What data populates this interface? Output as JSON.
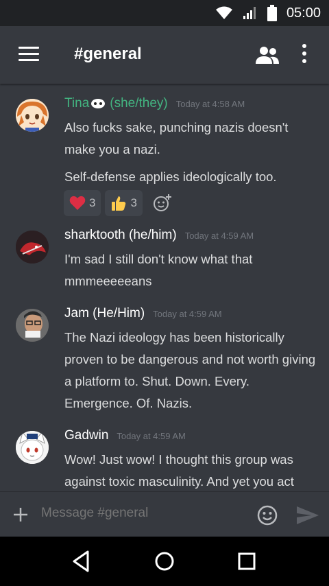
{
  "status_bar": {
    "time": "05:00"
  },
  "header": {
    "channel_title": "#general",
    "menu_icon": "hamburger-menu-icon",
    "members_icon": "members-icon",
    "more_icon": "more-vertical-icon"
  },
  "messages": [
    {
      "author": "Tina",
      "author_suffix": "(she/they)",
      "author_color": "#43b581",
      "timestamp": "Today at 4:58 AM",
      "lines": [
        "Also fucks sake, punching nazis doesn't make you a nazi.",
        "Self-defense applies ideologically too."
      ],
      "reactions": [
        {
          "emoji": "heart-emoji",
          "count": "3"
        },
        {
          "emoji": "thumbs-up-emoji",
          "count": "3"
        }
      ]
    },
    {
      "author": "sharktooth (he/him)",
      "timestamp": "Today at 4:59 AM",
      "lines": [
        "I'm sad I still don't know what that mmmeeeeeans"
      ]
    },
    {
      "author": "Jam (He/Him)",
      "timestamp": "Today at 4:59 AM",
      "lines": [
        "The Nazi ideology has been historically proven to be dangerous and not worth giving a platform to. Shut. Down. Every. Emergence. Of. Nazis."
      ]
    },
    {
      "author": "Gadwin",
      "timestamp": "Today at 4:59 AM",
      "lines": [
        "Wow! Just wow! I thought this group was against toxic masculinity. And yet you act"
      ]
    }
  ],
  "composer": {
    "placeholder": "Message #general"
  },
  "colors": {
    "background": "#36393f",
    "status_bar": "#202225",
    "tina_name": "#43b581",
    "reaction_bg": "#40444b",
    "heart": "#dd2e44",
    "thumbs": "#ffcc4d"
  }
}
